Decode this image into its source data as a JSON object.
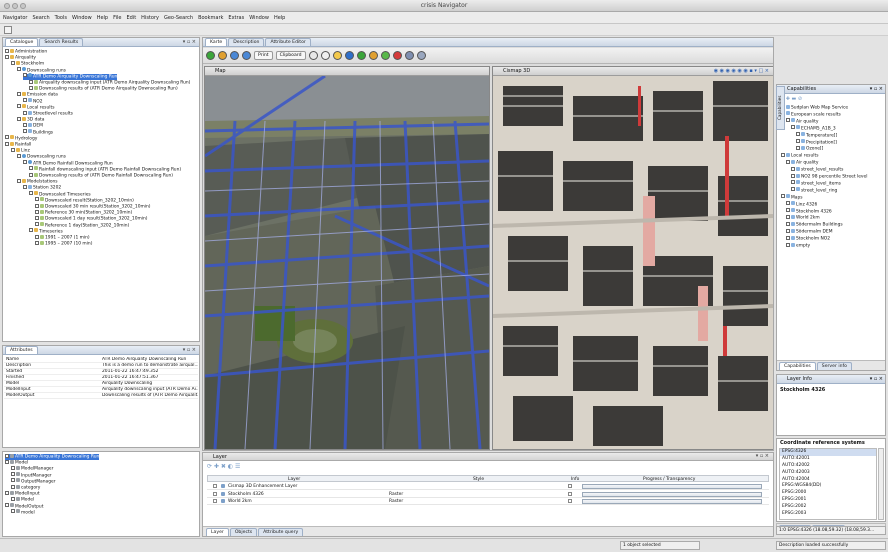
{
  "app": {
    "title": "crisis Navigator"
  },
  "menu": [
    "Navigator",
    "Search",
    "Tools",
    "Window",
    "Help",
    "File",
    "Edit",
    "History",
    "Geo-Search",
    "Bookmark",
    "Extras",
    "Window",
    "Help"
  ],
  "catalogue": {
    "tabs": [
      "Catalogue",
      "Search Results"
    ],
    "items": [
      {
        "label": "Administration",
        "indent": 0,
        "icon": "folder"
      },
      {
        "label": "Airquality",
        "indent": 0,
        "icon": "folder"
      },
      {
        "label": "Stockholm",
        "indent": 1,
        "icon": "folder"
      },
      {
        "label": "Downscaling runs",
        "indent": 2,
        "icon": "run"
      },
      {
        "label": "ATR Demo Airquality Downscaling Run",
        "indent": 3,
        "icon": "run",
        "selected": true
      },
      {
        "label": "Airquality downscaling input (ATR Demo Airquality Downscaling Run)",
        "indent": 4,
        "icon": "doc"
      },
      {
        "label": "Downscaling results of (ATR Demo Airquality Downscaling Run)",
        "indent": 4,
        "icon": "doc"
      },
      {
        "label": "Emission data",
        "indent": 2,
        "icon": "folder"
      },
      {
        "label": "NO2",
        "indent": 3,
        "icon": "res"
      },
      {
        "label": "Local results",
        "indent": 2,
        "icon": "folder"
      },
      {
        "label": "Streetlevel results",
        "indent": 3,
        "icon": "res"
      },
      {
        "label": "3D data",
        "indent": 2,
        "icon": "folder"
      },
      {
        "label": "DEM",
        "indent": 3,
        "icon": "res"
      },
      {
        "label": "Buildings",
        "indent": 3,
        "icon": "res"
      },
      {
        "label": "Hydrology",
        "indent": 0,
        "icon": "folder"
      },
      {
        "label": "Rainfall",
        "indent": 0,
        "icon": "folder"
      },
      {
        "label": "Linz",
        "indent": 1,
        "icon": "folder"
      },
      {
        "label": "Downscaling runs",
        "indent": 2,
        "icon": "run"
      },
      {
        "label": "ATR Demo Rainfall Downscaling Run",
        "indent": 3,
        "icon": "run"
      },
      {
        "label": "Rainfall downscaling input (ATR Demo Rainfall Downscaling Run)",
        "indent": 4,
        "icon": "doc"
      },
      {
        "label": "Downscaling results of (ATR Demo Rainfall Downscaling Run)",
        "indent": 4,
        "icon": "doc"
      },
      {
        "label": "Modelstations",
        "indent": 2,
        "icon": "folder"
      },
      {
        "label": "Station 3202",
        "indent": 3,
        "icon": "res"
      },
      {
        "label": "Downscaled Timeseries",
        "indent": 4,
        "icon": "folder"
      },
      {
        "label": "Downscaled result(Station_3202_10min)",
        "indent": 5,
        "icon": "doc"
      },
      {
        "label": "Downscaled 30 min result(Station_3202_10min)",
        "indent": 5,
        "icon": "doc"
      },
      {
        "label": "Reference 30 min(Station_3202_10min)",
        "indent": 5,
        "icon": "doc"
      },
      {
        "label": "Downscaled 1 day result(Station_3202_10min)",
        "indent": 5,
        "icon": "doc"
      },
      {
        "label": "Reference 1 day(Station_3202_10min)",
        "indent": 5,
        "icon": "doc"
      },
      {
        "label": "Timeseries",
        "indent": 4,
        "icon": "folder"
      },
      {
        "label": "1991 – 2007 (1 min)",
        "indent": 5,
        "icon": "doc"
      },
      {
        "label": "1995 – 2007 (10 min)",
        "indent": 5,
        "icon": "doc"
      }
    ]
  },
  "attributes": {
    "tab": "Attributes",
    "rows": [
      {
        "key": "Name",
        "value": "ATR Demo Airquality Downscaling Run"
      },
      {
        "key": "Description",
        "value": "This is a demo run to demonstrate airqual..."
      },
      {
        "key": "Started",
        "value": "2011-01-22 16:47:49.352"
      },
      {
        "key": "Finished",
        "value": "2011-01-22 16:47:51.367"
      },
      {
        "key": "Model",
        "value": "Airquality Downscaling"
      },
      {
        "key": "ModelInput",
        "value": "Airquality downscaling input (ATR Demo Ai..."
      },
      {
        "key": "ModelOutput",
        "value": "Downscaling results of (ATR Demo Airqualit..."
      }
    ]
  },
  "modeltree": {
    "items": [
      {
        "label": "ATR Demo Airquality Downscaling Run",
        "indent": 0,
        "selected": true
      },
      {
        "label": "Model",
        "indent": 0
      },
      {
        "label": "ModelManager",
        "indent": 1
      },
      {
        "label": "InputManager",
        "indent": 1
      },
      {
        "label": "OutputManager",
        "indent": 1
      },
      {
        "label": "category",
        "indent": 1
      },
      {
        "label": "ModelInput",
        "indent": 0
      },
      {
        "label": "Model",
        "indent": 1
      },
      {
        "label": "ModelOutput",
        "indent": 0
      },
      {
        "label": "model",
        "indent": 1
      }
    ]
  },
  "center": {
    "tabs": [
      "Karte",
      "Description",
      "Attribute Editor"
    ],
    "toolbar": {
      "print": "Print",
      "clipboard": "Clipboard"
    },
    "map_title": "Map",
    "cismap_title": "Cismap 3D"
  },
  "layer": {
    "title": "Layer",
    "columns": [
      "Layer",
      "Style",
      "Info",
      "Progress / Transparency"
    ],
    "rows": [
      {
        "name": "Cismap 3D Enhancement Layer",
        "style": ""
      },
      {
        "name": "Stockholm 4326",
        "style": "Raster"
      },
      {
        "name": "World 2km",
        "style": "Raster"
      }
    ],
    "bottom_tabs": [
      "Layer",
      "Objects",
      "Attribute query"
    ]
  },
  "capabilities": {
    "title": "Capabilities",
    "side_tab": "Capabilities",
    "items": [
      {
        "label": "Sudplan Web Map Service",
        "indent": 0
      },
      {
        "label": "European scale results",
        "indent": 0
      },
      {
        "label": "Air quality",
        "indent": 1
      },
      {
        "label": "ECHAM5_A1B_3",
        "indent": 2
      },
      {
        "label": "Temperature[]",
        "indent": 3
      },
      {
        "label": "Precipitation[]",
        "indent": 3
      },
      {
        "label": "Ozone[]",
        "indent": 3
      },
      {
        "label": "Local results",
        "indent": 0
      },
      {
        "label": "Air quality",
        "indent": 1
      },
      {
        "label": "street_level_results",
        "indent": 2
      },
      {
        "label": "NO2 98 percentile Street level",
        "indent": 2
      },
      {
        "label": "street_level_items",
        "indent": 2
      },
      {
        "label": "street_level_ring",
        "indent": 2
      },
      {
        "label": "Maps",
        "indent": 0
      },
      {
        "label": "Linz 4326",
        "indent": 1
      },
      {
        "label": "Stockholm 4326",
        "indent": 1
      },
      {
        "label": "World 2km",
        "indent": 1
      },
      {
        "label": "Södermalm Buildings",
        "indent": 1
      },
      {
        "label": "Södermalm DEM",
        "indent": 1
      },
      {
        "label": "Stockholm NO2",
        "indent": 1
      },
      {
        "label": "empty",
        "indent": 1
      }
    ],
    "tabs": [
      "Capabilities",
      "Server info"
    ]
  },
  "layerinfo": {
    "title": "Layer Info",
    "name": "Stockholm 4326"
  },
  "crs": {
    "title": "Coordinate reference systems",
    "items": [
      "EPSG:4326",
      "AUTO:42001",
      "AUTO:42002",
      "AUTO:42003",
      "AUTO:42004",
      "EPSG:WGS84(DD)",
      "EPSG:2000",
      "EPSG:2001",
      "EPSG:2002",
      "EPSG:2003"
    ]
  },
  "right_bottom_tabs": [
    "Overview",
    "Layer info"
  ],
  "status": {
    "coords": "1:0 EPSG:4326 (18.08,59.32) (18.08,59.3...",
    "selected": "1 object selected",
    "loaded": "Description loaded successfully"
  }
}
